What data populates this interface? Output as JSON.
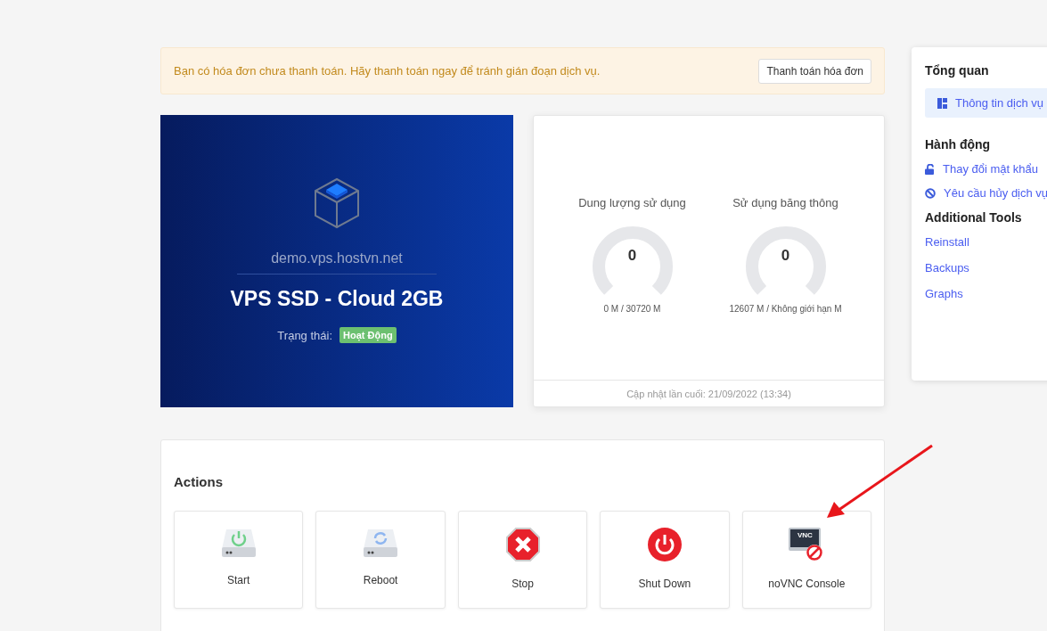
{
  "alert": {
    "message": "Bạn có hóa đơn chưa thanh toán. Hãy thanh toán ngay để tránh gián đoạn dịch vụ.",
    "button": "Thanh toán hóa đơn"
  },
  "product": {
    "hostname": "demo.vps.hostvn.net",
    "name": "VPS SSD - Cloud 2GB",
    "status_label": "Trạng thái:",
    "status": "Hoạt Động"
  },
  "usage": {
    "gauges": [
      {
        "title": "Dung lượng sử dụng",
        "value": "0",
        "detail": "0 M / 30720 M"
      },
      {
        "title": "Sử dụng băng thông",
        "value": "0",
        "detail": "12607 M / Không giới hạn M"
      }
    ],
    "updated": "Cập nhật lần cuối: 21/09/2022 (13:34)"
  },
  "actions": {
    "title": "Actions",
    "items": [
      {
        "kind": "start",
        "label": "Start"
      },
      {
        "kind": "reboot",
        "label": "Reboot"
      },
      {
        "kind": "stop",
        "label": "Stop"
      },
      {
        "kind": "shutdown",
        "label": "Shut Down"
      },
      {
        "kind": "console",
        "label": "noVNC Console",
        "icon_text": "VNC"
      }
    ]
  },
  "sidebar": {
    "sections": [
      {
        "title": "Tổng quan",
        "items": [
          {
            "kind": "overview",
            "label": "Thông tin dịch vụ",
            "selected": true
          }
        ]
      },
      {
        "title": "Hành động",
        "items": [
          {
            "kind": "lock",
            "label": "Thay đổi mật khẩu",
            "selected": false
          },
          {
            "kind": "ban",
            "label": "Yêu cầu hủy dịch vụ",
            "selected": false
          }
        ]
      },
      {
        "title": "Additional Tools",
        "items": [
          {
            "kind": "plain",
            "label": "Reinstall",
            "selected": false
          },
          {
            "kind": "plain",
            "label": "Backups",
            "selected": false
          },
          {
            "kind": "plain",
            "label": "Graphs",
            "selected": false
          }
        ]
      }
    ]
  }
}
